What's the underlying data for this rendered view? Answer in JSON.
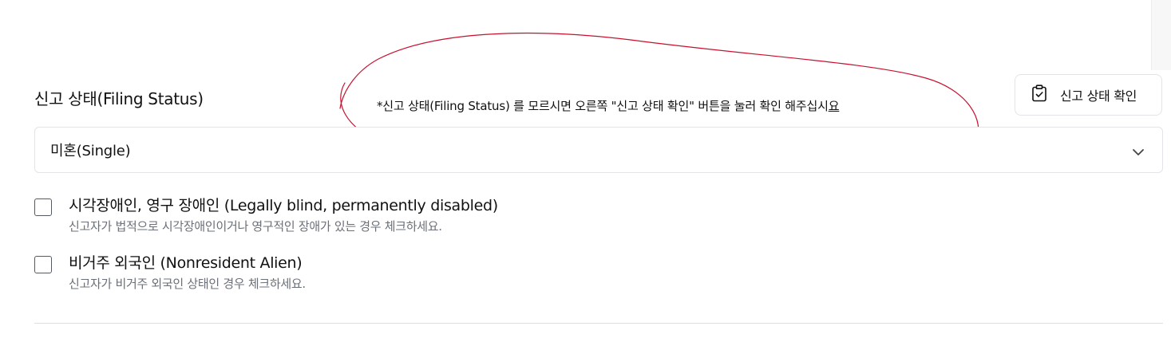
{
  "filing_status": {
    "label": "신고 상태(Filing Status)",
    "help_note_main": "*신고 상태(Filing Status) 를 모르시면 오른쪽 \"신고 상태 확인\" 버튼을 눌러 확인 해주십시",
    "help_note_tail": "요",
    "check_button_label": "신고 상태 확인",
    "check_button_icon": "clipboard-check-icon",
    "selected_value": "미혼(Single)",
    "dropdown_icon": "chevron-down-icon"
  },
  "checkboxes": [
    {
      "title": "시각장애인, 영구 장애인 (Legally blind, permanently disabled)",
      "description": "신고자가 법적으로 시각장애인이거나 영구적인 장애가 있는 경우 체크하세요.",
      "checked": false
    },
    {
      "title": "비거주 외국인 (Nonresident Alien)",
      "description": "신고자가 비거주 외국인 상태인 경우 체크하세요.",
      "checked": false
    }
  ],
  "colors": {
    "annotation_stroke": "#c8102e",
    "border": "#e2e4e8",
    "muted_text": "#6b7078"
  }
}
